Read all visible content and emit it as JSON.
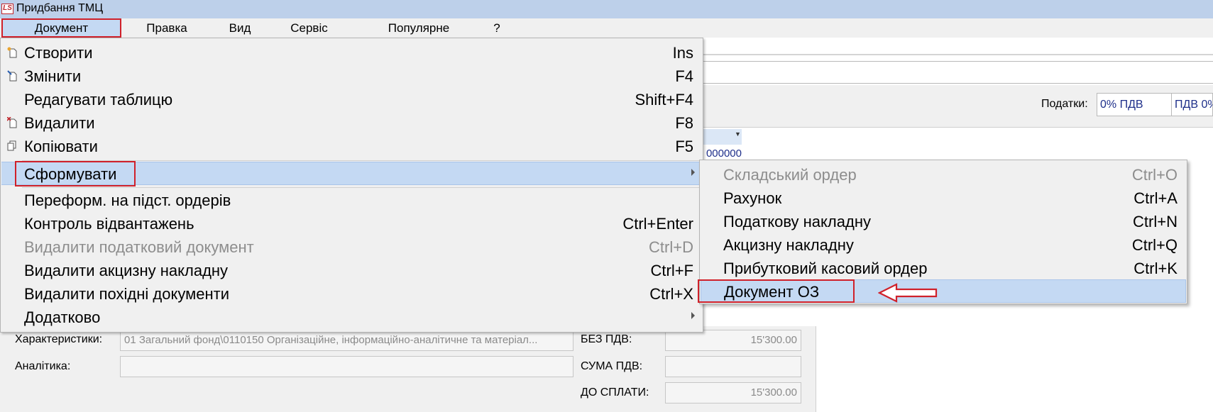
{
  "window": {
    "title": "Придбання ТМЦ",
    "icon": "ls-logo-icon"
  },
  "menubar": {
    "items": [
      "Документ",
      "Правка",
      "Вид",
      "Сервіс",
      "Популярне",
      "?"
    ],
    "active": "Документ"
  },
  "toolbar": {
    "taxes_label": "Податки:",
    "tax_value_1": "0% ПДВ",
    "tax_value_2": "ПДВ 0%"
  },
  "grid": {
    "visible_cell": "000000"
  },
  "document_menu": {
    "items": [
      {
        "label": "Створити",
        "shortcut": "Ins",
        "icon": "create-doc-icon"
      },
      {
        "label": "Змінити",
        "shortcut": "F4",
        "icon": "edit-doc-icon"
      },
      {
        "label": "Редагувати таблицю",
        "shortcut": "Shift+F4"
      },
      {
        "label": "Видалити",
        "shortcut": "F8",
        "icon": "delete-doc-icon"
      },
      {
        "label": "Копіювати",
        "shortcut": "F5",
        "icon": "copy-doc-icon"
      },
      {
        "label": "Сформувати",
        "shortcut": "",
        "submenu": true,
        "highlighted": true
      },
      {
        "label": "Переформ. на підст. ордерів",
        "shortcut": ""
      },
      {
        "label": "Контроль відвантажень",
        "shortcut": "Ctrl+Enter"
      },
      {
        "label": "Видалити податковий документ",
        "shortcut": "Ctrl+D",
        "disabled": true
      },
      {
        "label": "Видалити акцизну накладну",
        "shortcut": "Ctrl+F"
      },
      {
        "label": "Видалити похідні документи",
        "shortcut": "Ctrl+X"
      },
      {
        "label": "Додатково",
        "shortcut": "",
        "submenu": true
      }
    ]
  },
  "form_submenu": {
    "items": [
      {
        "label": "Складський ордер",
        "shortcut": "Ctrl+O",
        "disabled": true
      },
      {
        "label": "Рахунок",
        "shortcut": "Ctrl+A"
      },
      {
        "label": "Податкову накладну",
        "shortcut": "Ctrl+N"
      },
      {
        "label": "Акцизну накладну",
        "shortcut": "Ctrl+Q"
      },
      {
        "label": "Прибутковий касовий ордер",
        "shortcut": "Ctrl+K"
      },
      {
        "label": "Документ ОЗ",
        "shortcut": "",
        "highlighted": true
      }
    ]
  },
  "form": {
    "characteristics_label": "Характеристики:",
    "characteristics_value": "01 Загальний фонд\\0110150 Організаційне, інформаційно-аналітичне та матеріал...",
    "analytics_label": "Аналітика:",
    "analytics_value": "",
    "no_vat_label": "БЕЗ ПДВ:",
    "no_vat_value": "15'300.00",
    "vat_sum_label": "СУМА ПДВ:",
    "vat_sum_value": "",
    "to_pay_label": "ДО СПЛАТИ:",
    "to_pay_value": "15'300.00"
  },
  "colors": {
    "highlight": "#c4d9f3",
    "annotation_red": "#d0212a",
    "titlebar": "#bdd0ea",
    "menu_bg": "#f0f0f0"
  }
}
